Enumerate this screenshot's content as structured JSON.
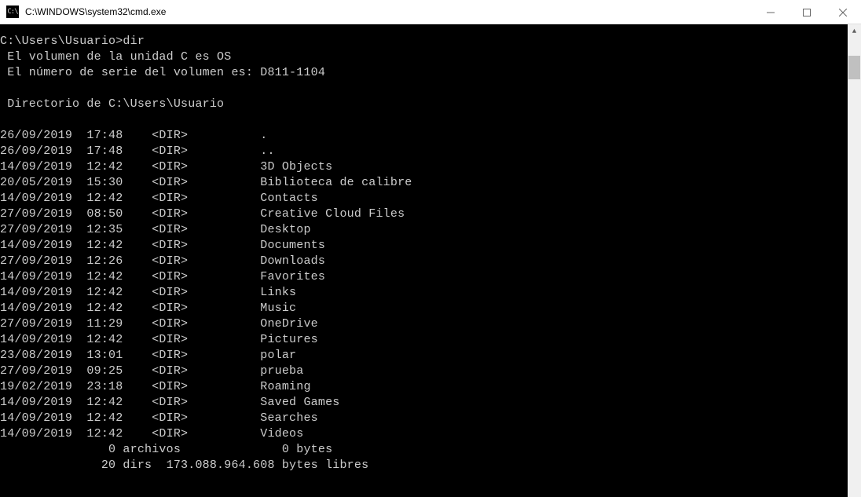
{
  "titlebar": {
    "icon_label": "C:\\",
    "title": "C:\\WINDOWS\\system32\\cmd.exe"
  },
  "terminal": {
    "prompt_line": "C:\\Users\\Usuario>dir",
    "volume_line": " El volumen de la unidad C es OS",
    "serial_line": " El número de serie del volumen es: D811-1104",
    "directory_line": " Directorio de C:\\Users\\Usuario",
    "entries": [
      {
        "date": "26/09/2019",
        "time": "17:48",
        "type": "<DIR>",
        "name": "."
      },
      {
        "date": "26/09/2019",
        "time": "17:48",
        "type": "<DIR>",
        "name": ".."
      },
      {
        "date": "14/09/2019",
        "time": "12:42",
        "type": "<DIR>",
        "name": "3D Objects"
      },
      {
        "date": "20/05/2019",
        "time": "15:30",
        "type": "<DIR>",
        "name": "Biblioteca de calibre"
      },
      {
        "date": "14/09/2019",
        "time": "12:42",
        "type": "<DIR>",
        "name": "Contacts"
      },
      {
        "date": "27/09/2019",
        "time": "08:50",
        "type": "<DIR>",
        "name": "Creative Cloud Files"
      },
      {
        "date": "27/09/2019",
        "time": "12:35",
        "type": "<DIR>",
        "name": "Desktop"
      },
      {
        "date": "14/09/2019",
        "time": "12:42",
        "type": "<DIR>",
        "name": "Documents"
      },
      {
        "date": "27/09/2019",
        "time": "12:26",
        "type": "<DIR>",
        "name": "Downloads"
      },
      {
        "date": "14/09/2019",
        "time": "12:42",
        "type": "<DIR>",
        "name": "Favorites"
      },
      {
        "date": "14/09/2019",
        "time": "12:42",
        "type": "<DIR>",
        "name": "Links"
      },
      {
        "date": "14/09/2019",
        "time": "12:42",
        "type": "<DIR>",
        "name": "Music"
      },
      {
        "date": "27/09/2019",
        "time": "11:29",
        "type": "<DIR>",
        "name": "OneDrive"
      },
      {
        "date": "14/09/2019",
        "time": "12:42",
        "type": "<DIR>",
        "name": "Pictures"
      },
      {
        "date": "23/08/2019",
        "time": "13:01",
        "type": "<DIR>",
        "name": "polar"
      },
      {
        "date": "27/09/2019",
        "time": "09:25",
        "type": "<DIR>",
        "name": "prueba"
      },
      {
        "date": "19/02/2019",
        "time": "23:18",
        "type": "<DIR>",
        "name": "Roaming"
      },
      {
        "date": "14/09/2019",
        "time": "12:42",
        "type": "<DIR>",
        "name": "Saved Games"
      },
      {
        "date": "14/09/2019",
        "time": "12:42",
        "type": "<DIR>",
        "name": "Searches"
      },
      {
        "date": "14/09/2019",
        "time": "12:42",
        "type": "<DIR>",
        "name": "Videos"
      }
    ],
    "summary_files": "               0 archivos              0 bytes",
    "summary_dirs": "              20 dirs  173.088.964.608 bytes libres"
  }
}
